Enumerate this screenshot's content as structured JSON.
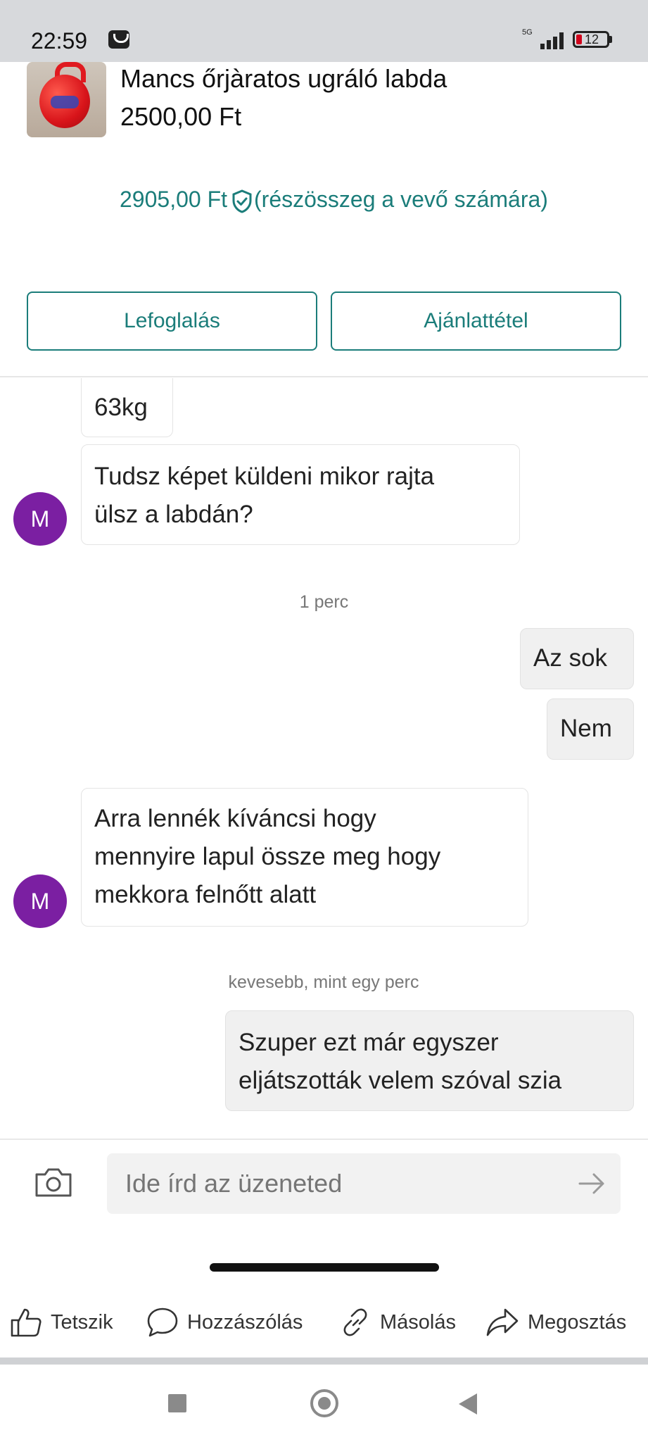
{
  "status_bar": {
    "time": "22:59",
    "network": "5G",
    "battery": "12"
  },
  "product": {
    "title": "Mancs őrjàratos ugráló labda",
    "price": "2500,00 Ft",
    "total_price": "2905,00 Ft",
    "total_note": "(részösszeg a vevő számára)"
  },
  "actions": {
    "reserve_label": "Lefoglalás",
    "offer_label": "Ajánlattétel"
  },
  "chat": {
    "messages": [
      {
        "lines": [
          "63kg"
        ]
      },
      {
        "avatar": "M",
        "lines": [
          "Tudsz képet küldeni mikor rajta",
          "ülsz a labdán?"
        ]
      },
      {
        "time": "1 perc"
      },
      {
        "lines": [
          "Az sok"
        ]
      },
      {
        "lines": [
          "Nem"
        ]
      },
      {
        "avatar": "M",
        "lines": [
          "Arra lennék kíváncsi hogy",
          "mennyire lapul össze meg hogy",
          "mekkora felnőtt alatt"
        ]
      },
      {
        "time": "kevesebb, mint egy perc"
      },
      {
        "lines": [
          "Szuper ezt már egyszer",
          "eljátszották velem szóval szia"
        ]
      }
    ]
  },
  "composer": {
    "placeholder": "Ide írd az üzeneted"
  },
  "share_bar": {
    "like": "Tetszik",
    "comment": "Hozzászólás",
    "copy": "Másolás",
    "share": "Megosztás"
  },
  "colors": {
    "accent": "#1b7d7a",
    "avatar": "#7b1fa2",
    "own_bubble": "#f0f0f0"
  }
}
